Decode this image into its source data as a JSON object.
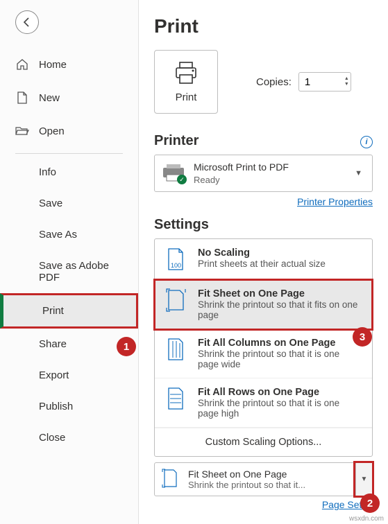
{
  "back": "←",
  "nav": {
    "home": "Home",
    "new": "New",
    "open": "Open"
  },
  "subnav": {
    "info": "Info",
    "save": "Save",
    "saveas": "Save As",
    "saveadobe": "Save as Adobe PDF",
    "print": "Print",
    "share": "Share",
    "export": "Export",
    "publish": "Publish",
    "close": "Close"
  },
  "title": "Print",
  "print_btn": "Print",
  "copies_label": "Copies:",
  "copies_value": "1",
  "printer_section": "Printer",
  "printer": {
    "name": "Microsoft Print to PDF",
    "status": "Ready"
  },
  "printer_props": "Printer Properties",
  "settings_section": "Settings",
  "options": {
    "noscale": {
      "title": "No Scaling",
      "desc": "Print sheets at their actual size"
    },
    "fitsheet": {
      "title": "Fit Sheet on One Page",
      "desc": "Shrink the printout so that it fits on one page"
    },
    "fitcols": {
      "title": "Fit All Columns on One Page",
      "desc": "Shrink the printout so that it is one page wide"
    },
    "fitrows": {
      "title": "Fit All Rows on One Page",
      "desc": "Shrink the printout so that it is one page high"
    },
    "custom": "Custom Scaling Options..."
  },
  "current": {
    "title": "Fit Sheet on One Page",
    "desc": "Shrink the printout so that it..."
  },
  "page_setup": "Page Setup",
  "callouts": {
    "c1": "1",
    "c2": "2",
    "c3": "3"
  },
  "watermark": "wsxdn.com"
}
